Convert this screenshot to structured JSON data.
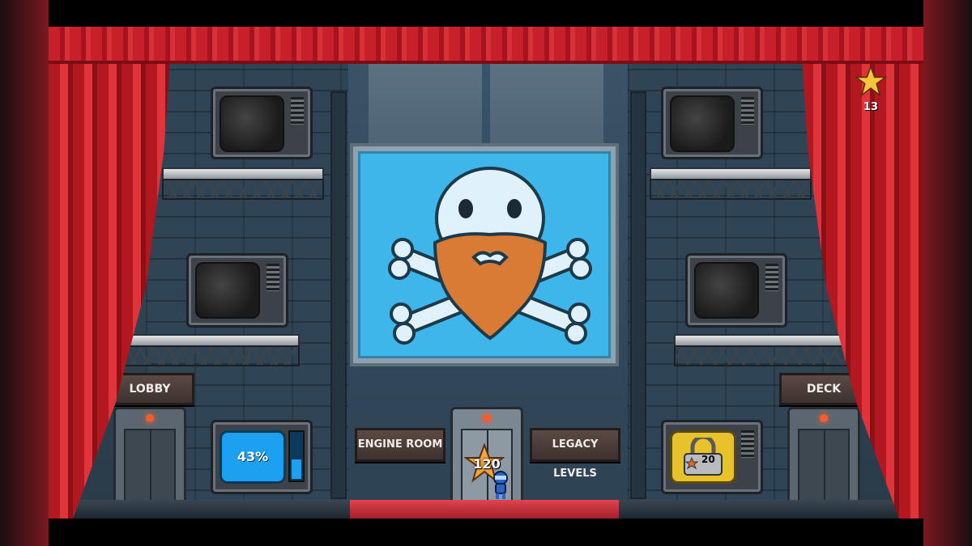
{
  "hud": {
    "star_count": "13"
  },
  "signs": {
    "lobby": "LOBBY",
    "deck": "DECK",
    "engine_room": "ENGINE ROOM",
    "legacy_levels": "LEGACY LEVELS"
  },
  "monitors": {
    "progress_percent": "43%",
    "progress_fill": 0.43,
    "locked_star_requirement": "20"
  },
  "center_door": {
    "star_requirement": "120"
  },
  "colors": {
    "curtain": "#c8202a",
    "screen_blue": "#3fb6ea",
    "beard": "#d97b34",
    "lock_gold": "#e8c22a",
    "progress_screen": "#1ea0f0"
  }
}
